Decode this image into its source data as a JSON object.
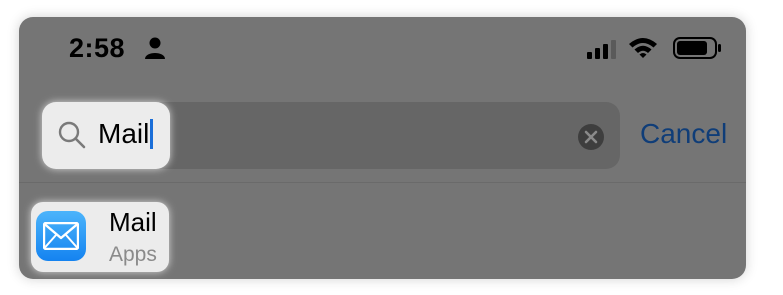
{
  "status_bar": {
    "time": "2:58",
    "icons": [
      "person-icon",
      "cellular-signal-icon",
      "wifi-icon",
      "battery-icon"
    ]
  },
  "search": {
    "value": "Mail",
    "icon": "magnifying-glass-icon",
    "clear_icon": "clear-x-icon",
    "cancel_label": "Cancel"
  },
  "results": [
    {
      "title": "Mail",
      "subtitle": "Apps",
      "icon": "mail-app-icon"
    }
  ],
  "colors": {
    "overlay": "#757575",
    "search_field": "#666666",
    "cancel_text": "#0f3d78",
    "mail_icon_top": "#4cb4fb",
    "mail_icon_bottom": "#1483f0",
    "caret": "#1a6ed8"
  }
}
